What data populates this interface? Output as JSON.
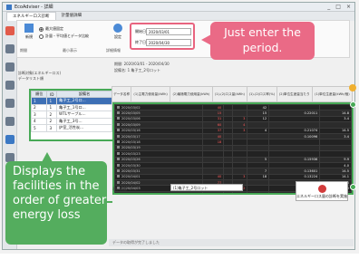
{
  "window": {
    "title": "EcoAdviser - 詳細",
    "controls": [
      "_",
      "□",
      "×"
    ]
  },
  "tabs": [
    {
      "label": "エネルギーロス診断"
    },
    {
      "label": "計量値詳細"
    }
  ],
  "toolbar": {
    "new_label": "新規",
    "settings_label": "設定",
    "options": [
      {
        "label": "最大値固定",
        "selected": true
      },
      {
        "label": "計量・平均値とデータ比較",
        "selected": false
      }
    ],
    "section_labels": [
      "期間",
      "最小表示",
      "詳細情報"
    ],
    "start_label": "開始日",
    "end_label": "終了日",
    "start_value": "2020/03/01",
    "end_value": "2020/04/30"
  },
  "callouts": {
    "period": "Just enter the period.",
    "facilities": "Displays the facilities in the order of greater energy loss"
  },
  "info": {
    "line1": "期間: 2020/03/01 - 2020/04/30",
    "line2": "設備名: 1 亀子工_2号ロット",
    "left_caption": "診断対象(エネルギーロス)",
    "left_caption2": "データリスト順"
  },
  "facility_list": {
    "headers": [
      "順位",
      "ID",
      "設備名"
    ],
    "rows": [
      [
        "1",
        "1",
        "亀子工_2号ロ..."
      ],
      [
        "2",
        "1",
        "亀子工_1号ロ..."
      ],
      [
        "3",
        "2",
        "WTLサーブル..."
      ],
      [
        "4",
        "2",
        "亀子工_3号..."
      ],
      [
        "5",
        "3",
        "炉室_活性炭..."
      ]
    ]
  },
  "grid": {
    "headers": [
      "データ名称",
      "(1)主電力使用量(kWh)",
      "(2)最適電力使用量(kWh)",
      "(1)-(2)ロス量(kWh)",
      "(1)-(2)ロス率(%)",
      "(2)単位生産量当たり",
      "(1)単位生産量(kWh/個)"
    ],
    "rows": [
      [
        "2020/03/02",
        "40",
        "",
        "",
        "42",
        "",
        ""
      ],
      [
        "2020/03/05",
        "15",
        "",
        "",
        "15",
        "0.22011",
        "14.8"
      ],
      [
        "2020/03/06",
        "31",
        "",
        "3",
        "12",
        "",
        "3.4"
      ],
      [
        "2020/03/09",
        "60",
        "",
        "4",
        "",
        "",
        ""
      ],
      [
        "2020/03/16",
        "37",
        "",
        "3",
        "4",
        "0.21074",
        "14.5"
      ],
      [
        "2020/03/17",
        "40",
        "",
        "",
        "",
        "0.10096",
        "3.4"
      ],
      [
        "2020/03/18",
        "18",
        "",
        "",
        "",
        "",
        ""
      ],
      [
        "2020/03/19",
        "",
        "",
        "",
        "",
        "",
        ""
      ],
      [
        "2020/03/23",
        "",
        "",
        "",
        "",
        "",
        ""
      ],
      [
        "2020/03/26",
        "",
        "",
        "",
        "5",
        "0.15936",
        "9.9"
      ],
      [
        "2020/03/30",
        "",
        "",
        "",
        "",
        "",
        "4.0"
      ],
      [
        "2020/03/31",
        "",
        "",
        "",
        "7",
        "0.13601",
        "14.5"
      ],
      [
        "2020/04/01",
        "40",
        "",
        "3",
        "18",
        "0.13224",
        "14.1"
      ],
      [
        "2020/04/02",
        "77",
        "",
        "",
        "",
        "",
        "14.5"
      ],
      [
        "2020/04/03",
        "84",
        "",
        "2",
        "",
        "0.13290",
        "14.0"
      ],
      [
        "2020/04/06",
        "",
        "",
        "",
        "",
        "",
        ""
      ]
    ],
    "red_cols": [
      1,
      3
    ]
  },
  "bottom": {
    "label": "表示期間",
    "select_value": "(1)亀子工_2号ロット",
    "export_label": "エネルギーロス量の診断を実施"
  },
  "status": {
    "text": "データの取得が完了しました"
  }
}
